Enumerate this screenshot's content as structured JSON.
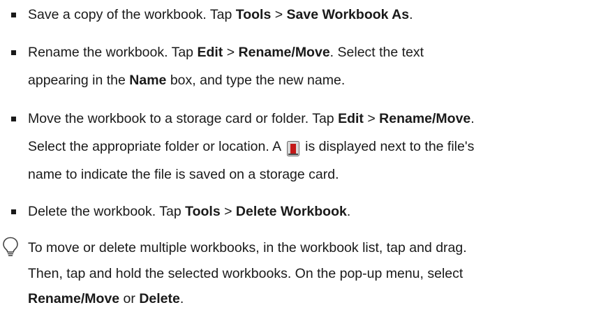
{
  "items": [
    {
      "lines": [
        {
          "parts": [
            {
              "t": "Save a copy of the workbook. Tap "
            },
            {
              "t": "Tools",
              "b": true
            },
            {
              "t": " > "
            },
            {
              "t": "Save Workbook As",
              "b": true
            },
            {
              "t": "."
            }
          ]
        }
      ]
    },
    {
      "lines": [
        {
          "parts": [
            {
              "t": "Rename the workbook. Tap "
            },
            {
              "t": "Edit",
              "b": true
            },
            {
              "t": " > "
            },
            {
              "t": "Rename/Move",
              "b": true
            },
            {
              "t": ". Select the text"
            }
          ]
        },
        {
          "parts": [
            {
              "t": "appearing in the "
            },
            {
              "t": "Name",
              "b": true
            },
            {
              "t": " box, and type the new name."
            }
          ]
        }
      ]
    },
    {
      "lines": [
        {
          "parts": [
            {
              "t": "Move the workbook to a storage card or folder. Tap "
            },
            {
              "t": "Edit",
              "b": true
            },
            {
              "t": " > "
            },
            {
              "t": "Rename/Move",
              "b": true
            },
            {
              "t": "."
            }
          ]
        },
        {
          "parts": [
            {
              "t": "Select the appropriate folder or location. A"
            },
            {
              "icon": "storage-card-icon"
            },
            {
              "t": "is displayed next to the file's"
            }
          ]
        },
        {
          "parts": [
            {
              "t": "name to indicate the file is saved on a storage card."
            }
          ]
        }
      ]
    },
    {
      "lines": [
        {
          "parts": [
            {
              "t": "Delete the workbook. Tap "
            },
            {
              "t": "Tools",
              "b": true
            },
            {
              "t": " > "
            },
            {
              "t": "Delete Workbook",
              "b": true
            },
            {
              "t": "."
            }
          ]
        }
      ]
    }
  ],
  "tip": {
    "icon": "lightbulb-tip-icon",
    "lines": [
      {
        "parts": [
          {
            "t": "To move or delete multiple workbooks, in the workbook list, tap and drag."
          }
        ]
      },
      {
        "parts": [
          {
            "t": "Then, tap and hold the selected workbooks. On the pop-up menu, select"
          }
        ]
      },
      {
        "parts": [
          {
            "t": "Rename/Move",
            "b": true
          },
          {
            "t": " or "
          },
          {
            "t": "Delete",
            "b": true
          },
          {
            "t": "."
          }
        ]
      }
    ]
  }
}
